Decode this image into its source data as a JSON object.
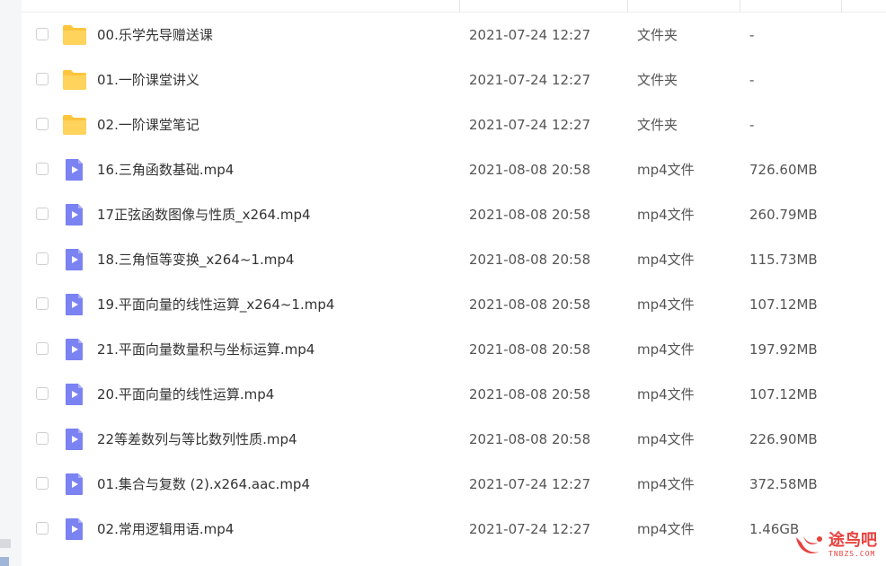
{
  "colors": {
    "folder": "#ffc53d",
    "video_icon": "#7b82f2",
    "watermark": "#e8423f"
  },
  "files": [
    {
      "name": "00.乐学先导赠送课",
      "date": "2021-07-24 12:27",
      "type": "文件夹",
      "size": "-",
      "icon": "folder-icon"
    },
    {
      "name": "01.一阶课堂讲义",
      "date": "2021-07-24 12:27",
      "type": "文件夹",
      "size": "-",
      "icon": "folder-icon"
    },
    {
      "name": "02.一阶课堂笔记",
      "date": "2021-07-24 12:27",
      "type": "文件夹",
      "size": "-",
      "icon": "folder-icon"
    },
    {
      "name": "16.三角函数基础.mp4",
      "date": "2021-08-08 20:58",
      "type": "mp4文件",
      "size": "726.60MB",
      "icon": "video-file-icon"
    },
    {
      "name": "17正弦函数图像与性质_x264.mp4",
      "date": "2021-08-08 20:58",
      "type": "mp4文件",
      "size": "260.79MB",
      "icon": "video-file-icon"
    },
    {
      "name": "18.三角恒等变换_x264~1.mp4",
      "date": "2021-08-08 20:58",
      "type": "mp4文件",
      "size": "115.73MB",
      "icon": "video-file-icon"
    },
    {
      "name": "19.平面向量的线性运算_x264~1.mp4",
      "date": "2021-08-08 20:58",
      "type": "mp4文件",
      "size": "107.12MB",
      "icon": "video-file-icon"
    },
    {
      "name": "21.平面向量数量积与坐标运算.mp4",
      "date": "2021-08-08 20:58",
      "type": "mp4文件",
      "size": "197.92MB",
      "icon": "video-file-icon"
    },
    {
      "name": "20.平面向量的线性运算.mp4",
      "date": "2021-08-08 20:58",
      "type": "mp4文件",
      "size": "107.12MB",
      "icon": "video-file-icon"
    },
    {
      "name": "22等差数列与等比数列性质.mp4",
      "date": "2021-08-08 20:58",
      "type": "mp4文件",
      "size": "226.90MB",
      "icon": "video-file-icon"
    },
    {
      "name": "01.集合与复数 (2).x264.aac.mp4",
      "date": "2021-07-24 12:27",
      "type": "mp4文件",
      "size": "372.58MB",
      "icon": "video-file-icon"
    },
    {
      "name": "02.常用逻辑用语.mp4",
      "date": "2021-07-24 12:27",
      "type": "mp4文件",
      "size": "1.46GB",
      "icon": "video-file-icon"
    }
  ],
  "watermark": {
    "text": "途鸟吧",
    "sub": "TNBZS.COM"
  }
}
